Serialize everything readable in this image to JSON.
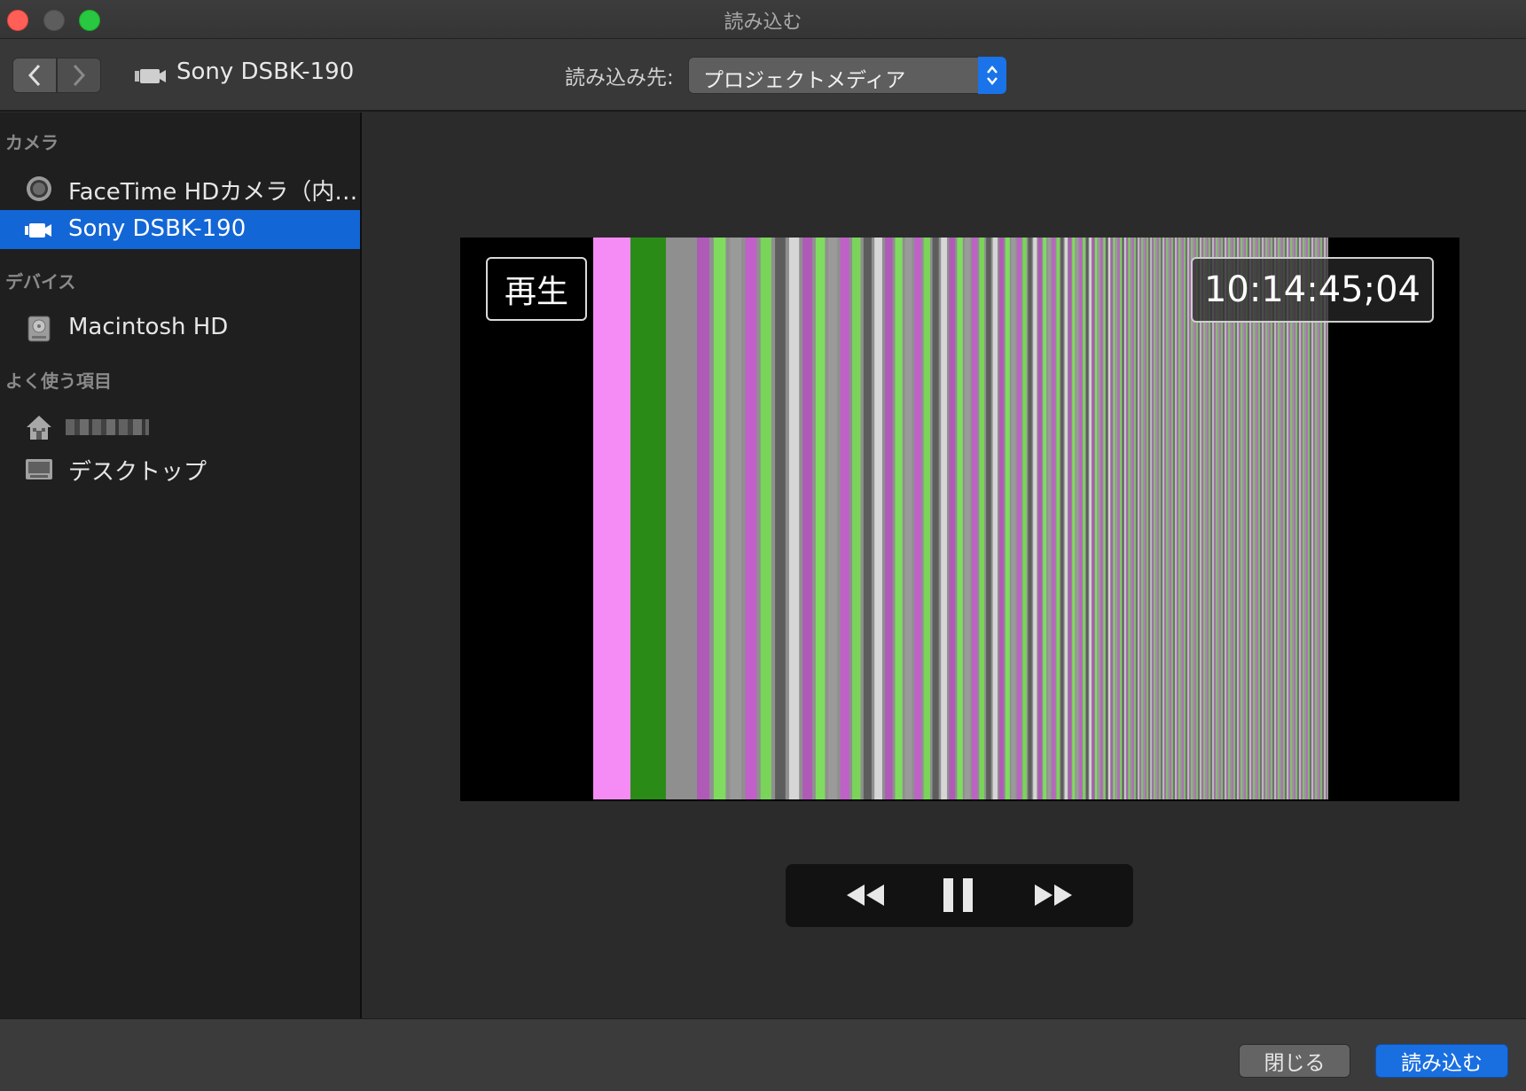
{
  "window": {
    "title": "読み込む"
  },
  "toolbar": {
    "device_name": "Sony DSBK-190",
    "import_to_label": "読み込み先:",
    "destination": "プロジェクトメディア"
  },
  "sidebar": {
    "sections": [
      {
        "heading": "カメラ",
        "items": [
          {
            "label": "FaceTime HDカメラ（内…",
            "icon": "webcam-icon",
            "selected": false
          },
          {
            "label": "Sony DSBK-190",
            "icon": "camcorder-icon",
            "selected": true
          }
        ]
      },
      {
        "heading": "デバイス",
        "items": [
          {
            "label": "Macintosh HD",
            "icon": "hard-drive-icon",
            "selected": false
          }
        ]
      },
      {
        "heading": "よく使う項目",
        "items": [
          {
            "label": "",
            "icon": "home-icon",
            "selected": false
          },
          {
            "label": "デスクトップ",
            "icon": "desktop-folder-icon",
            "selected": false
          }
        ]
      }
    ]
  },
  "viewer": {
    "status_label": "再生",
    "timecode": "10:14:45;04"
  },
  "footer": {
    "close_label": "閉じる",
    "import_label": "読み込む"
  },
  "colors": {
    "accent": "#1a6fe0",
    "bar_magenta": "#f58cf5",
    "bar_green": "#2a8c17",
    "bar_gray": "#8f8f8f"
  }
}
